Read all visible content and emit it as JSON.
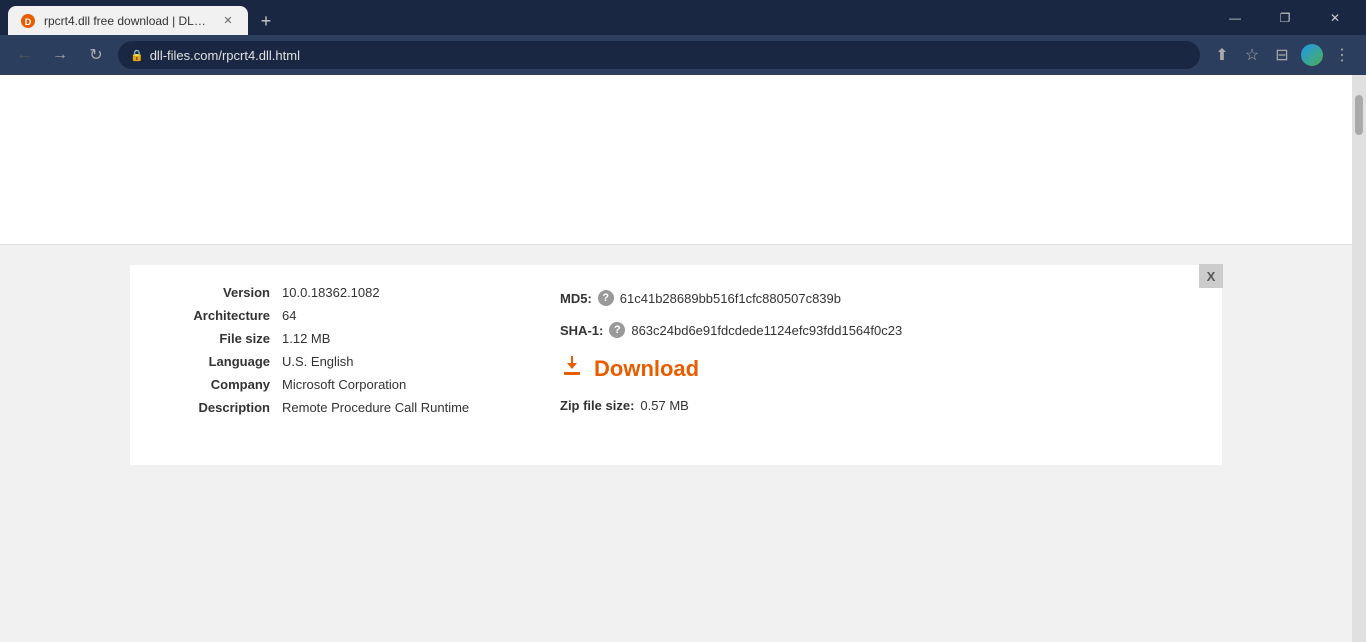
{
  "browser": {
    "tab": {
      "title": "rpcrt4.dll free download | DLL-file...",
      "favicon_color": "#e85d00"
    },
    "address": "dll-files.com/rpcrt4.dll.html",
    "window_controls": {
      "minimize": "—",
      "maximize": "❐",
      "close": "✕"
    }
  },
  "toolbar": {
    "back_label": "←",
    "forward_label": "→",
    "reload_label": "↻",
    "share_label": "⬆",
    "bookmark_label": "☆",
    "sidebar_label": "⊟",
    "menu_label": "⋮"
  },
  "file_info": {
    "version_label": "Version",
    "version_value": "10.0.18362.1082",
    "arch_label": "Architecture",
    "arch_value": "64",
    "filesize_label": "File size",
    "filesize_value": "1.12 MB",
    "language_label": "Language",
    "language_value": "U.S. English",
    "company_label": "Company",
    "company_value": "Microsoft Corporation",
    "description_label": "Description",
    "description_value": "Remote Procedure Call Runtime"
  },
  "hash_info": {
    "md5_label": "MD5:",
    "md5_value": "61c41b28689bb516f1cfc880507c839b",
    "sha1_label": "SHA-1:",
    "sha1_value": "863c24bd6e91fdcdede1124efc93fdd1564f0c23",
    "download_label": "Download",
    "zip_size_label": "Zip file size:",
    "zip_size_value": "0.57 MB"
  },
  "close_label": "X"
}
